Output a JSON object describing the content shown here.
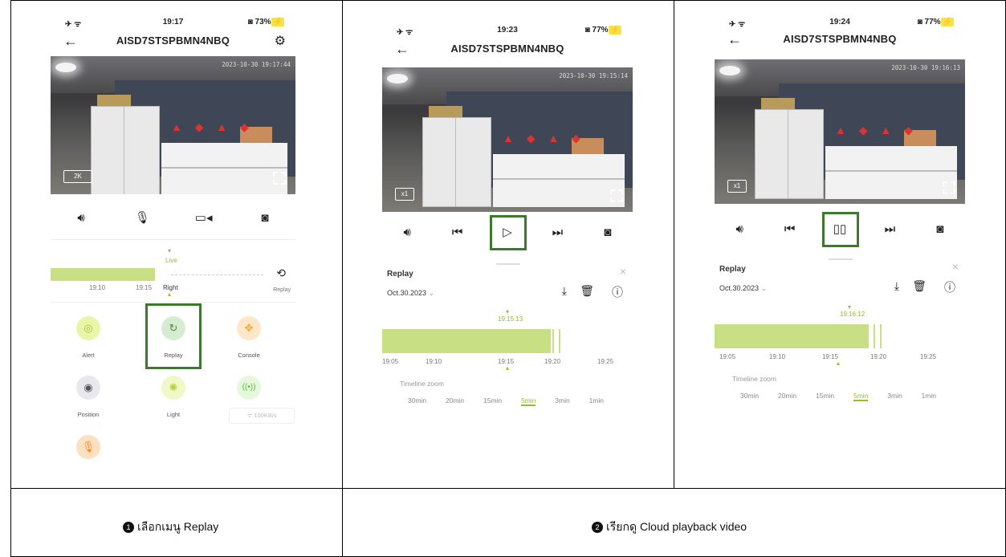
{
  "panels": [
    {
      "status_left": "✈ ᯤ",
      "time": "19:17",
      "battery": "73%",
      "device": "AISD7STSPBMN4NBQ",
      "timestamp": "2023-10-30 19:17:44",
      "quality": "2K",
      "live_label": "Live",
      "right_label": "Right",
      "ticks": [
        "19:10",
        "19:15"
      ],
      "replay_small": "Replay",
      "functions": [
        {
          "label": "Alert",
          "icon": "alert-icon"
        },
        {
          "label": "Replay",
          "icon": "replay-icon"
        },
        {
          "label": "Console",
          "icon": "console-icon"
        },
        {
          "label": "Position",
          "icon": "position-icon"
        },
        {
          "label": "Light",
          "icon": "light-icon"
        },
        {
          "label": "100KB/s",
          "icon": "wifi-signal-icon"
        }
      ]
    },
    {
      "status_left": "✈ ᯤ",
      "time": "19:23",
      "battery": "77%",
      "device": "AISD7STSPBMN4NBQ",
      "timestamp": "2023-10-30 19:15:14",
      "speed": "x1",
      "replay_title": "Replay",
      "date": "Oct.30.2023",
      "cursor_time": "19:15:13",
      "ticks": [
        "19:05",
        "19:10",
        "19:15",
        "19:20",
        "19:25"
      ],
      "zoom_label": "Timeline zoom",
      "zoom": [
        "30min",
        "20min",
        "15min",
        "5min",
        "3min",
        "1min"
      ],
      "zoom_selected": "5min"
    },
    {
      "status_left": "✈ ᯤ",
      "time": "19:24",
      "battery": "77%",
      "device": "AISD7STSPBMN4NBQ",
      "timestamp": "2023-10-30 19:16:13",
      "speed": "x1",
      "replay_title": "Replay",
      "date": "Oct.30.2023",
      "cursor_time": "19:16:12",
      "ticks": [
        "19:05",
        "19:10",
        "19:15",
        "19:20",
        "19:25"
      ],
      "zoom_label": "Timeline zoom",
      "zoom": [
        "30min",
        "20min",
        "15min",
        "5min",
        "3min",
        "1min"
      ],
      "zoom_selected": "5min"
    }
  ],
  "captions": {
    "step1_num": "1",
    "step1_text": "เลือกเมนู Replay",
    "step2_num": "2",
    "step2_text": "เรียกดู Cloud playback video"
  }
}
